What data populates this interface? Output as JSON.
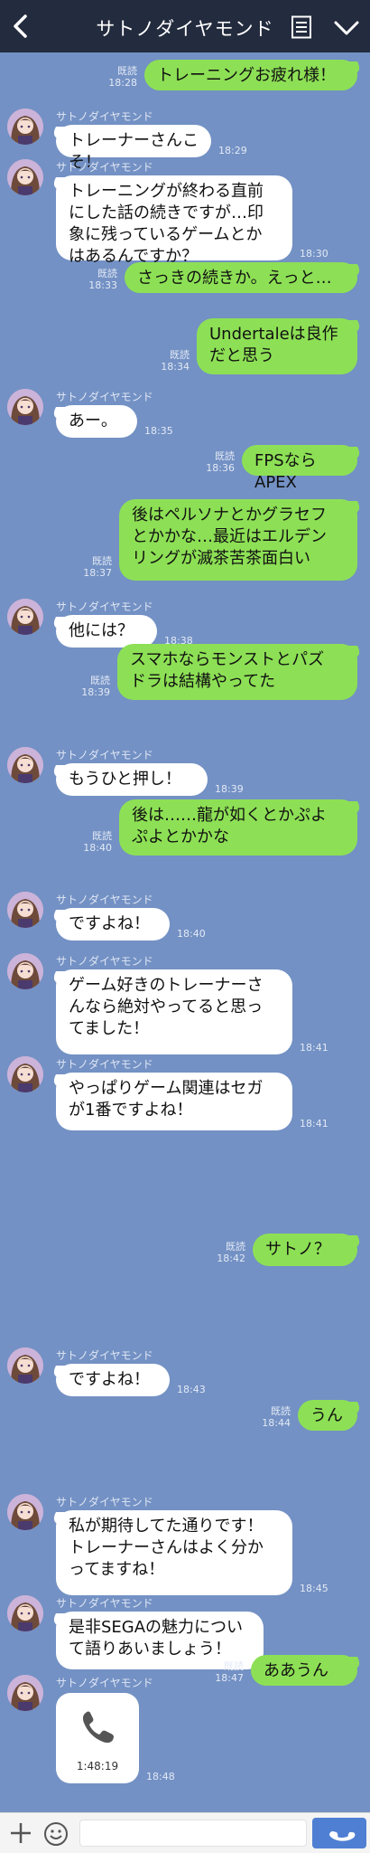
{
  "header": {
    "title": "サトノダイヤモンド"
  },
  "colors": {
    "background": "#7391c4",
    "header": "#232b3e",
    "outgoing_bubble": "#8de055",
    "incoming_bubble": "#ffffff",
    "send_button": "#4f7fd3"
  },
  "messages": [
    {
      "dir": "out",
      "text": "トレーニングお疲れ様！",
      "read": "既読",
      "time": "18:28"
    },
    {
      "dir": "in",
      "sender": "サトノダイヤモンド",
      "text": "トレーナーさんこそ！",
      "time": "18:29"
    },
    {
      "dir": "in",
      "sender": "サトノダイヤモンド",
      "text": "トレーニングが終わる直前\nにした話の続きですが…印\n象に残っているゲームとか\nはあるんですか？",
      "time": "18:30"
    },
    {
      "dir": "out",
      "text": "さっきの続きか。えっと…",
      "read": "既読",
      "time": "18:33"
    },
    {
      "dir": "out",
      "text": "Undertaleは良作\nだと思う",
      "read": "既読",
      "time": "18:34"
    },
    {
      "dir": "in",
      "sender": "サトノダイヤモンド",
      "text": "あー。",
      "time": "18:35"
    },
    {
      "dir": "out",
      "text": "FPSならAPEX",
      "read": "既読",
      "time": "18:36"
    },
    {
      "dir": "out",
      "text": "後はペルソナとかグラセフ\nとかかな…最近はエルデン\nリングが滅茶苦茶面白い",
      "read": "既読",
      "time": "18:37"
    },
    {
      "dir": "in",
      "sender": "サトノダイヤモンド",
      "text": "他には？",
      "time": "18:38"
    },
    {
      "dir": "out",
      "text": "スマホならモンストとパズ\nドラは結構やってた",
      "read": "既読",
      "time": "18:39"
    },
    {
      "dir": "in",
      "sender": "サトノダイヤモンド",
      "text": "もうひと押し！",
      "time": "18:39"
    },
    {
      "dir": "out",
      "text": "後は……龍が如くとかぷよ\nぷよとかかな",
      "read": "既読",
      "time": "18:40"
    },
    {
      "dir": "in",
      "sender": "サトノダイヤモンド",
      "text": "ですよね！",
      "time": "18:40"
    },
    {
      "dir": "in",
      "sender": "サトノダイヤモンド",
      "text": "ゲーム好きのトレーナーさ\nんなら絶対やってると思っ\nてました！",
      "time": "18:41"
    },
    {
      "dir": "in",
      "sender": "サトノダイヤモンド",
      "text": "やっぱりゲーム関連はセガ\nが1番ですよね！",
      "time": "18:41"
    },
    {
      "dir": "out",
      "text": "サトノ？",
      "read": "既読",
      "time": "18:42"
    },
    {
      "dir": "in",
      "sender": "サトノダイヤモンド",
      "text": "ですよね！",
      "time": "18:43"
    },
    {
      "dir": "out",
      "text": "うん",
      "read": "既読",
      "time": "18:44"
    },
    {
      "dir": "in",
      "sender": "サトノダイヤモンド",
      "text": "私が期待してた通りです！\nトレーナーさんはよく分か\nってますね！",
      "time": "18:45"
    },
    {
      "dir": "in",
      "sender": "サトノダイヤモンド",
      "text": "是非SEGAの魅力につい\nて語りあいましょう！",
      "time": "18:46"
    },
    {
      "dir": "out",
      "text": "ああうん",
      "read": "既読",
      "time": "18:47"
    }
  ],
  "call": {
    "sender": "サトノダイヤモンド",
    "icon": "phone-icon",
    "duration": "1:48:19",
    "time": "18:48"
  },
  "input": {
    "placeholder": "",
    "plus_icon": "plus-icon",
    "emoji_icon": "smiley-icon",
    "send_icon": "send-icon"
  }
}
